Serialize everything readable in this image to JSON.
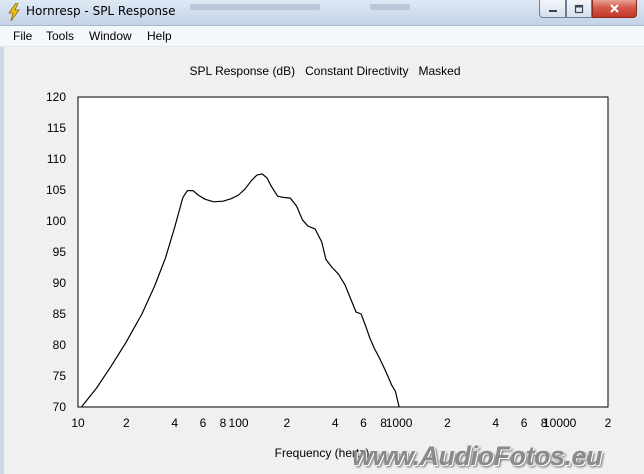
{
  "window": {
    "title": "Hornresp - SPL Response",
    "controls": {
      "minimize": "minimize",
      "maximize": "maximize",
      "close": "close"
    }
  },
  "menu": {
    "items": [
      "File",
      "Tools",
      "Window",
      "Help"
    ]
  },
  "chart_data": {
    "type": "line",
    "title": "SPL Response (dB)   Constant Directivity   Masked",
    "xlabel": "Frequency (hertz)",
    "ylabel": "",
    "x_scale": "log",
    "xlim": [
      10,
      20000
    ],
    "ylim": [
      70,
      120
    ],
    "grid": true,
    "x_tick_labels": [
      "10",
      "2",
      "4",
      "6",
      "8",
      "100",
      "2",
      "4",
      "6",
      "8",
      "1000",
      "2",
      "4",
      "6",
      "8",
      "10000",
      "2"
    ],
    "x_tick_values": [
      10,
      20,
      40,
      60,
      80,
      100,
      200,
      400,
      600,
      800,
      1000,
      2000,
      4000,
      6000,
      8000,
      10000,
      20000
    ],
    "y_tick_labels": [
      "70",
      "75",
      "80",
      "85",
      "90",
      "95",
      "100",
      "105",
      "110",
      "115",
      "120"
    ],
    "series": [
      {
        "x": [
          10.5,
          13,
          16,
          20,
          25,
          30,
          35,
          40,
          45,
          48,
          52,
          56,
          62,
          70,
          80,
          90,
          100,
          110,
          120,
          130,
          140,
          150,
          160,
          175,
          190,
          210,
          230,
          250,
          270,
          300,
          330,
          350,
          380,
          420,
          460,
          500,
          540,
          580,
          620,
          660,
          700,
          750,
          800,
          850,
          900,
          950,
          1000
        ],
        "y": [
          70,
          73,
          76.5,
          80.5,
          85,
          89.5,
          94,
          99,
          103.8,
          104.9,
          104.9,
          104.2,
          103.5,
          103.1,
          103.2,
          103.6,
          104.2,
          105.2,
          106.5,
          107.4,
          107.6,
          107,
          105.6,
          104,
          103.8,
          103.7,
          102.4,
          100.2,
          99.2,
          98.7,
          96.6,
          93.8,
          92.6,
          91.4,
          89.7,
          87.4,
          85.3,
          85,
          83,
          81,
          79.5,
          78,
          76.5,
          75,
          73.5,
          72.5,
          70
        ]
      }
    ],
    "colors": {
      "line": "#000000",
      "plot_bg": "#ffffff",
      "grid_major": "#c8c8c8",
      "grid_minor": "#e0e0e0"
    }
  },
  "watermark": {
    "text": "www.AudioFotos.eu"
  }
}
